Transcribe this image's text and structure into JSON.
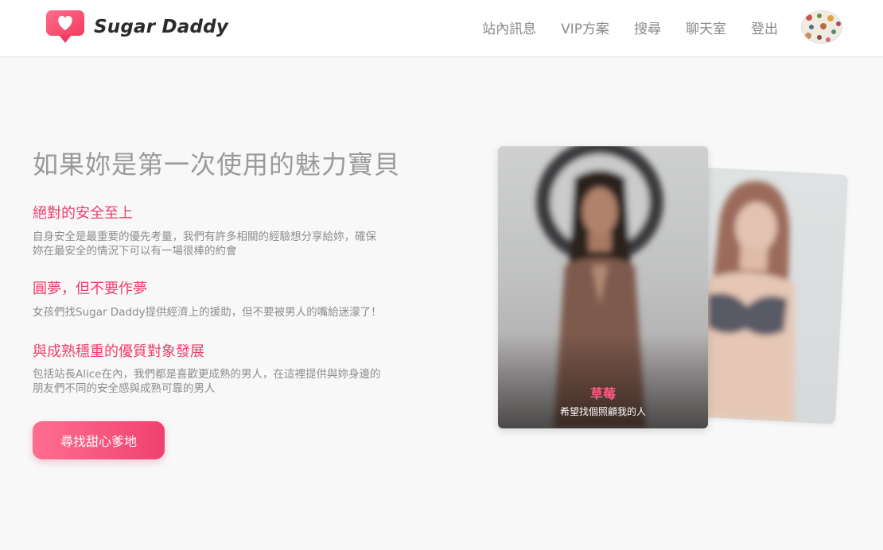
{
  "header": {
    "brand": "Sugar Daddy",
    "nav": [
      "站內訊息",
      "VIP方案",
      "搜尋",
      "聊天室",
      "登出"
    ]
  },
  "main": {
    "headline": "如果妳是第一次使用的魅力寶貝",
    "sections": [
      {
        "title": "絕對的安全至上",
        "body_lines": [
          "自身安全是最重要的優先考量，我們有許多相關的經驗想分享給妳，確保",
          "妳在最安全的情況下可以有一場很棒的約會"
        ]
      },
      {
        "title": "圓夢，但不要作夢",
        "body_lines": [
          "女孩們找Sugar Daddy提供經濟上的援助，但不要被男人的嘴給迷濛了！"
        ]
      },
      {
        "title": "與成熟穩重的優質對象發展",
        "body_lines": [
          "包括站長Alice在內，我們都是喜歡更成熟的男人，在這裡提供與妳身邊的",
          "朋友們不同的安全感與成熟可靠的男人"
        ]
      }
    ],
    "cta_label": "尋找甜心爹地"
  },
  "card": {
    "name": "草莓",
    "subtitle": "希望找個照顧我的人"
  },
  "colors": {
    "accent": "#ee3f6c",
    "nav_text": "#8a8a8a",
    "headline": "#9a9a9a"
  }
}
